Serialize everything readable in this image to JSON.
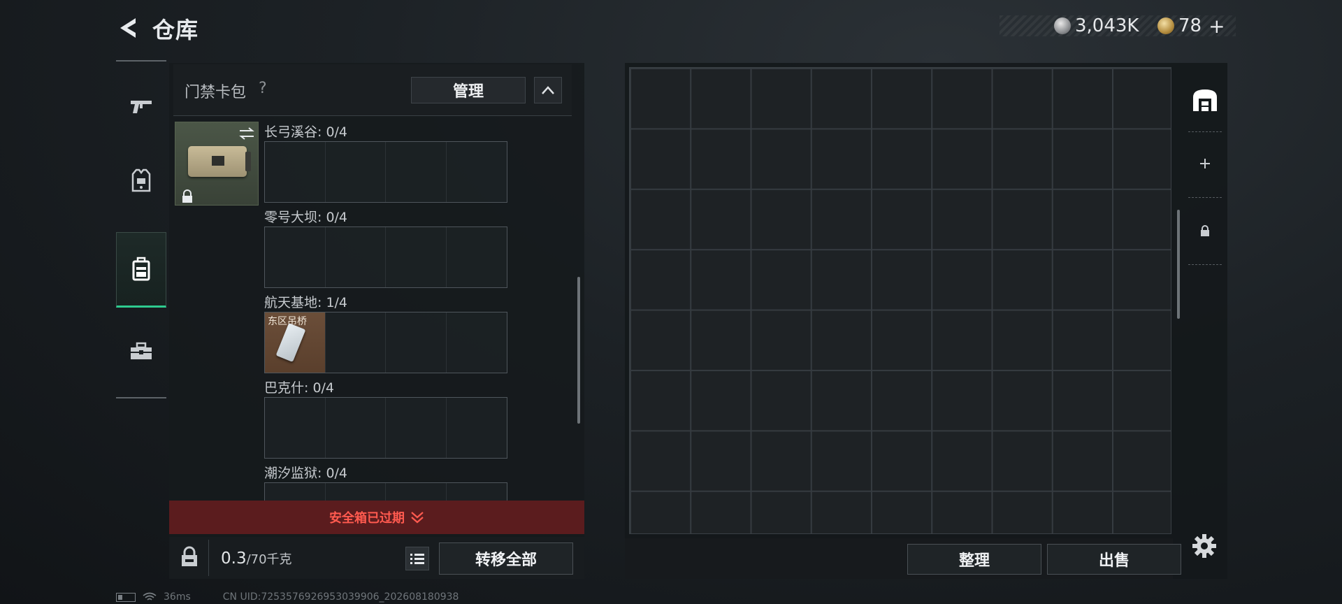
{
  "header": {
    "title": "仓库",
    "currency_silver": "3,043K",
    "currency_gold": "78",
    "plus_symbol": "+"
  },
  "left_rail": {
    "items": [
      {
        "name": "weapons",
        "icon": "gun-icon"
      },
      {
        "name": "armor",
        "icon": "vest-icon"
      },
      {
        "name": "backpack",
        "icon": "backpack-icon",
        "active": true
      },
      {
        "name": "toolbox",
        "icon": "toolbox-icon"
      }
    ]
  },
  "left_panel": {
    "section_title": "门禁卡包",
    "help": "?",
    "manage_label": "管理",
    "slots": [
      {
        "label": "长弓溪谷: 0/4",
        "cards": []
      },
      {
        "label": "零号大坝: 0/4",
        "cards": []
      },
      {
        "label": "航天基地: 1/4",
        "cards": [
          {
            "name": "东区吊桥"
          }
        ]
      },
      {
        "label": "巴克什: 0/4",
        "cards": []
      },
      {
        "label": "潮汐监狱: 0/4",
        "cards": []
      }
    ],
    "warning": "安全箱已过期",
    "weight_value": "0.3",
    "weight_max": "/70千克",
    "transfer_all_label": "转移全部"
  },
  "right_panel": {
    "tidy_label": "整理",
    "sell_label": "出售"
  },
  "status_bar": {
    "ping": "36ms",
    "uid": "CN UID:7253576926953039906_202608180938"
  },
  "colors": {
    "accent_green": "#2ecb8f",
    "warning_red": "#ff5a4f",
    "warning_bg": "#5b1c1e"
  }
}
